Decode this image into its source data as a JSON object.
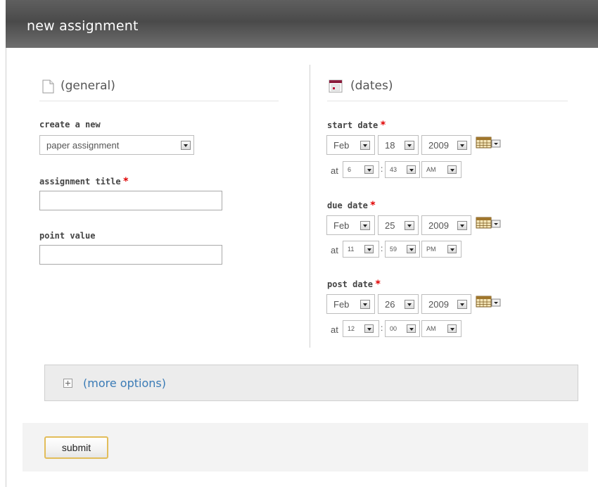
{
  "header": {
    "title": "new assignment"
  },
  "general": {
    "heading": "(general)",
    "create_label": "create a new",
    "create_value": "paper assignment",
    "title_label": "assignment title",
    "title_value": "",
    "points_label": "point value",
    "points_value": ""
  },
  "dates": {
    "heading": "(dates)",
    "at_label": "at",
    "colon": ":",
    "required_mark": "*",
    "groups": [
      {
        "label": "start date",
        "month": "Feb",
        "day": "18",
        "year": "2009",
        "hour": "6",
        "minute": "43",
        "ampm": "AM"
      },
      {
        "label": "due date",
        "month": "Feb",
        "day": "25",
        "year": "2009",
        "hour": "11",
        "minute": "59",
        "ampm": "PM"
      },
      {
        "label": "post date",
        "month": "Feb",
        "day": "26",
        "year": "2009",
        "hour": "12",
        "minute": "00",
        "ampm": "AM"
      }
    ]
  },
  "more_options": {
    "label": "(more options)"
  },
  "footer": {
    "submit_label": "submit"
  },
  "colors": {
    "header_bg": "#4f4f4f",
    "link": "#3a7bb6",
    "required": "#e00000",
    "submit_border": "#e2bd5a",
    "calendar_accent": "#8b1c3c"
  }
}
